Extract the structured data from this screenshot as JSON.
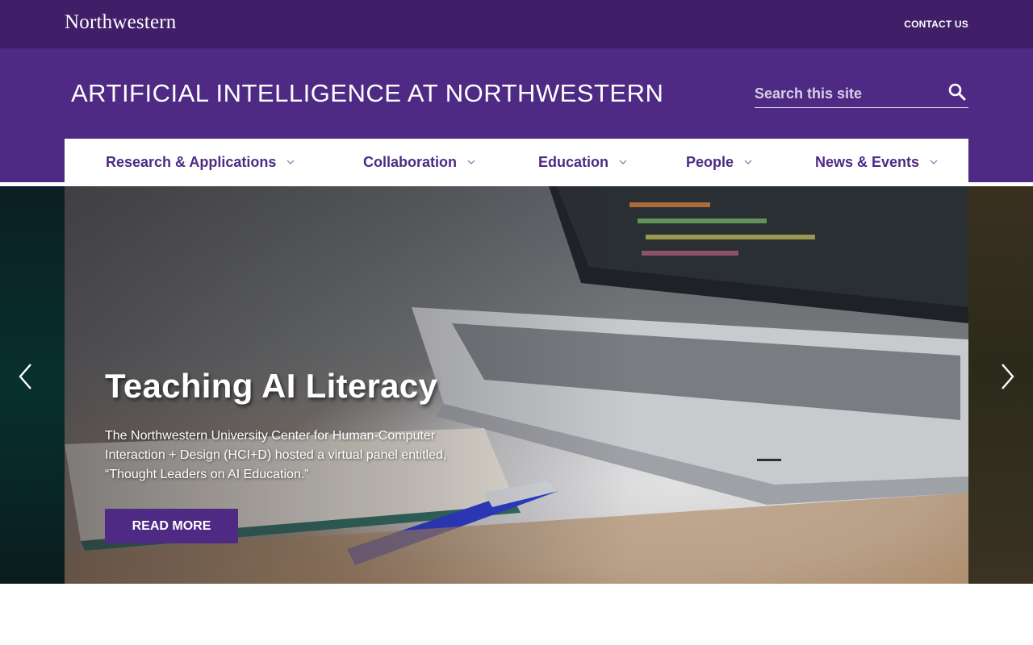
{
  "topbar": {
    "logo_text": "Northwestern",
    "contact_label": "CONTACT US"
  },
  "header": {
    "site_title": "ARTIFICIAL INTELLIGENCE AT NORTHWESTERN",
    "search_placeholder": "Search this site",
    "search_icon": "search-icon"
  },
  "nav": {
    "items": [
      {
        "label": "Research & Applications"
      },
      {
        "label": "Collaboration"
      },
      {
        "label": "Education"
      },
      {
        "label": "People"
      },
      {
        "label": "News & Events"
      }
    ]
  },
  "hero": {
    "title": "Teaching AI Literacy",
    "text": "The Northwestern University Center for Human-Computer Interaction + Design (HCI+D) hosted a virtual panel entitled, “Thought Leaders on AI Education.”",
    "button_label": "READ MORE",
    "prev_icon": "chevron-left-icon",
    "next_icon": "chevron-right-icon"
  },
  "colors": {
    "purple_dark": "#401f68",
    "purple": "#4e2a84",
    "white": "#ffffff"
  }
}
